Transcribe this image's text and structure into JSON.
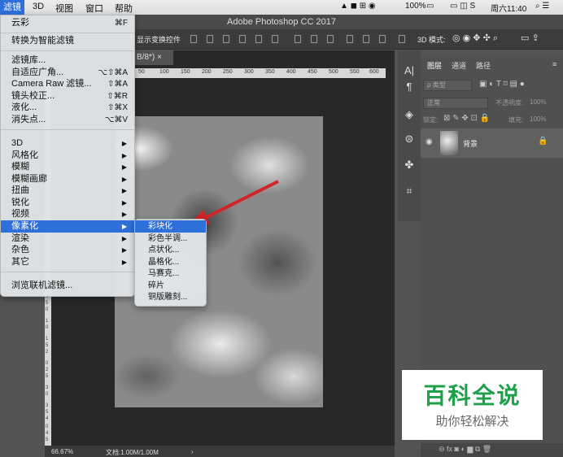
{
  "menubar": {
    "items": [
      "滤镜",
      "3D",
      "视图",
      "窗口",
      "帮助"
    ],
    "tray": {
      "battery": "100%",
      "clock": "周六11:40"
    }
  },
  "window": {
    "title": "Adobe Photoshop CC 2017"
  },
  "optionsbar": {
    "transform_label": "显示变换控件",
    "mode_label": "3D 模式:"
  },
  "document": {
    "tab_label": "B/8*) ×",
    "ruler_ticks": [
      "50",
      "100",
      "150",
      "200",
      "250",
      "300",
      "350",
      "400",
      "450",
      "500",
      "550",
      "600"
    ],
    "ruler_left_digits": [
      "0",
      "5",
      "0",
      "1",
      "0",
      "1",
      "5",
      "2",
      "0",
      "2",
      "5",
      "3",
      "0",
      "3",
      "5",
      "4",
      "0",
      "4",
      "5",
      "5",
      "0"
    ],
    "zoom": "66.67%",
    "doc_size": "文档:1.00M/1.00M",
    "arrow_color": "#d0242a"
  },
  "filter_menu": {
    "items": [
      {
        "label": "云彩",
        "shortcut": "⌘F"
      },
      {
        "label": "转换为智能滤镜"
      },
      {
        "label": "滤镜库..."
      },
      {
        "label": "自适应广角...",
        "shortcut": "⌥⇧⌘A"
      },
      {
        "label": "Camera Raw 滤镜...",
        "shortcut": "⇧⌘A"
      },
      {
        "label": "镜头校正...",
        "shortcut": "⇧⌘R"
      },
      {
        "label": "液化...",
        "shortcut": "⇧⌘X"
      },
      {
        "label": "消失点...",
        "shortcut": "⌥⌘V"
      },
      {
        "label": "3D",
        "submenu": true
      },
      {
        "label": "风格化",
        "submenu": true
      },
      {
        "label": "模糊",
        "submenu": true
      },
      {
        "label": "模糊画廊",
        "submenu": true
      },
      {
        "label": "扭曲",
        "submenu": true
      },
      {
        "label": "锐化",
        "submenu": true
      },
      {
        "label": "视频",
        "submenu": true
      },
      {
        "label": "像素化",
        "submenu": true,
        "highlighted": true
      },
      {
        "label": "渲染",
        "submenu": true
      },
      {
        "label": "杂色",
        "submenu": true
      },
      {
        "label": "其它",
        "submenu": true
      },
      {
        "label": "浏览联机滤镜..."
      }
    ]
  },
  "pixelate_menu": {
    "items": [
      "彩块化",
      "彩色半调...",
      "点状化...",
      "晶格化...",
      "马赛克...",
      "碎片",
      "铜版雕刻..."
    ]
  },
  "layers_panel": {
    "tabs": [
      "图层",
      "通道",
      "路径"
    ],
    "filter_kind": "ρ 类型",
    "blend_mode": "正常",
    "opacity_label": "不透明度:",
    "opacity_value": "100%",
    "lock_label": "锁定:",
    "fill_label": "填充:",
    "fill_value": "100%",
    "layer_name": "背景"
  },
  "watermark": {
    "title": "百科全说",
    "subtitle": "助你轻松解决",
    "color": "#1fa04a"
  }
}
